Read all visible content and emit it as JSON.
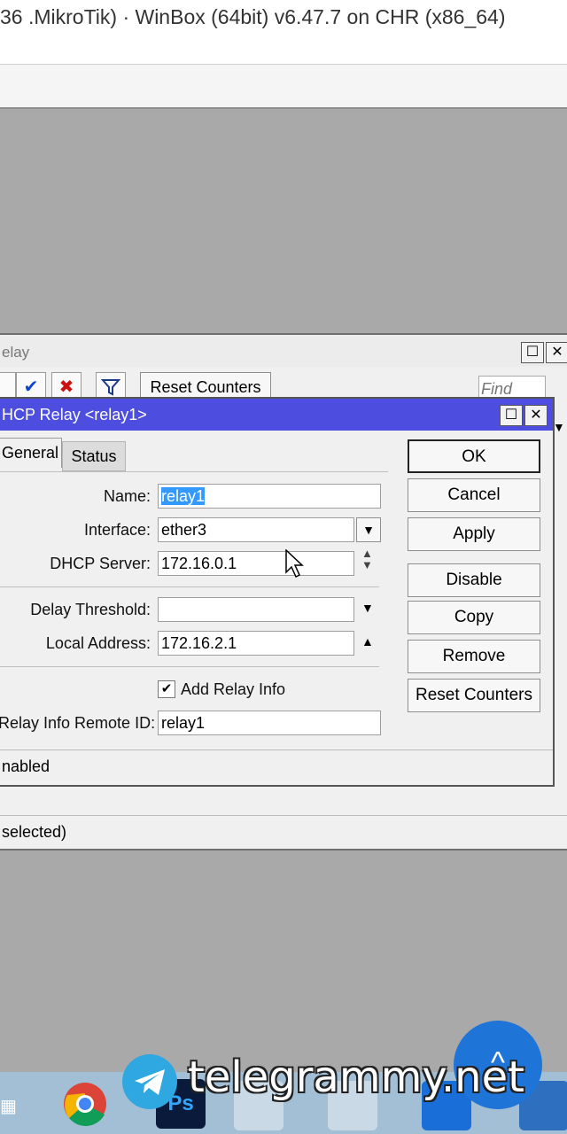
{
  "titlebar": {
    "text": "36 .MikroTik) · WinBox (64bit) v6.47.7 on CHR (x86_64)"
  },
  "relay_window": {
    "title": "elay",
    "reset_counters": "Reset Counters",
    "find_placeholder": "Find",
    "status_text": "selected)"
  },
  "dialog": {
    "title": "HCP Relay <relay1>",
    "tabs": [
      "General",
      "Status"
    ],
    "fields": {
      "name_label": "Name:",
      "name_value": "relay1",
      "interface_label": "Interface:",
      "interface_value": "ether3",
      "dhcp_server_label": "DHCP Server:",
      "dhcp_server_value": "172.16.0.1",
      "delay_threshold_label": "Delay Threshold:",
      "delay_threshold_value": "",
      "local_address_label": "Local Address:",
      "local_address_value": "172.16.2.1",
      "add_relay_info_label": "Add Relay Info",
      "add_relay_info_checked": true,
      "relay_info_remote_id_label": "Relay Info Remote ID:",
      "relay_info_remote_id_value": "relay1"
    },
    "buttons": {
      "ok": "OK",
      "cancel": "Cancel",
      "apply": "Apply",
      "disable": "Disable",
      "copy": "Copy",
      "remove": "Remove",
      "reset_counters": "Reset Counters"
    },
    "status": "nabled"
  },
  "watermark": "telegrammy.net",
  "colors": {
    "dialog_title": "#4d4de0",
    "selection": "#3399ff",
    "fab": "#1f74d8"
  }
}
